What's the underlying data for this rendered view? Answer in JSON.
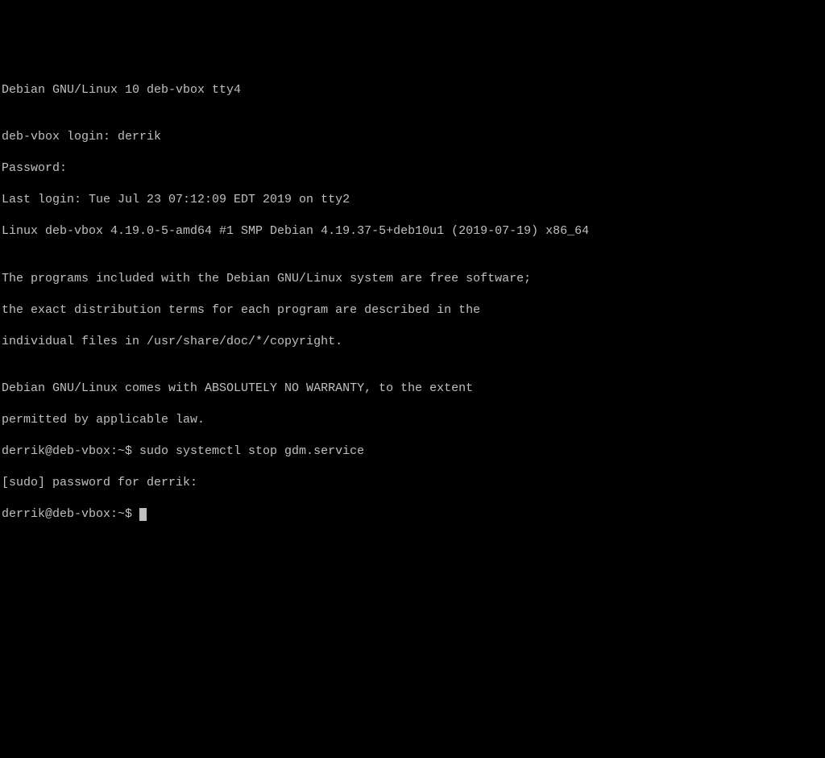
{
  "terminal": {
    "lines": [
      "Debian GNU/Linux 10 deb-vbox tty4",
      "",
      "deb-vbox login: derrik",
      "Password:",
      "Last login: Tue Jul 23 07:12:09 EDT 2019 on tty2",
      "Linux deb-vbox 4.19.0-5-amd64 #1 SMP Debian 4.19.37-5+deb10u1 (2019-07-19) x86_64",
      "",
      "The programs included with the Debian GNU/Linux system are free software;",
      "the exact distribution terms for each program are described in the",
      "individual files in /usr/share/doc/*/copyright.",
      "",
      "Debian GNU/Linux comes with ABSOLUTELY NO WARRANTY, to the extent",
      "permitted by applicable law.",
      "derrik@deb-vbox:~$ sudo systemctl stop gdm.service",
      "[sudo] password for derrik:",
      "derrik@deb-vbox:~$"
    ],
    "prompt_user": "derrik",
    "prompt_host": "deb-vbox"
  }
}
